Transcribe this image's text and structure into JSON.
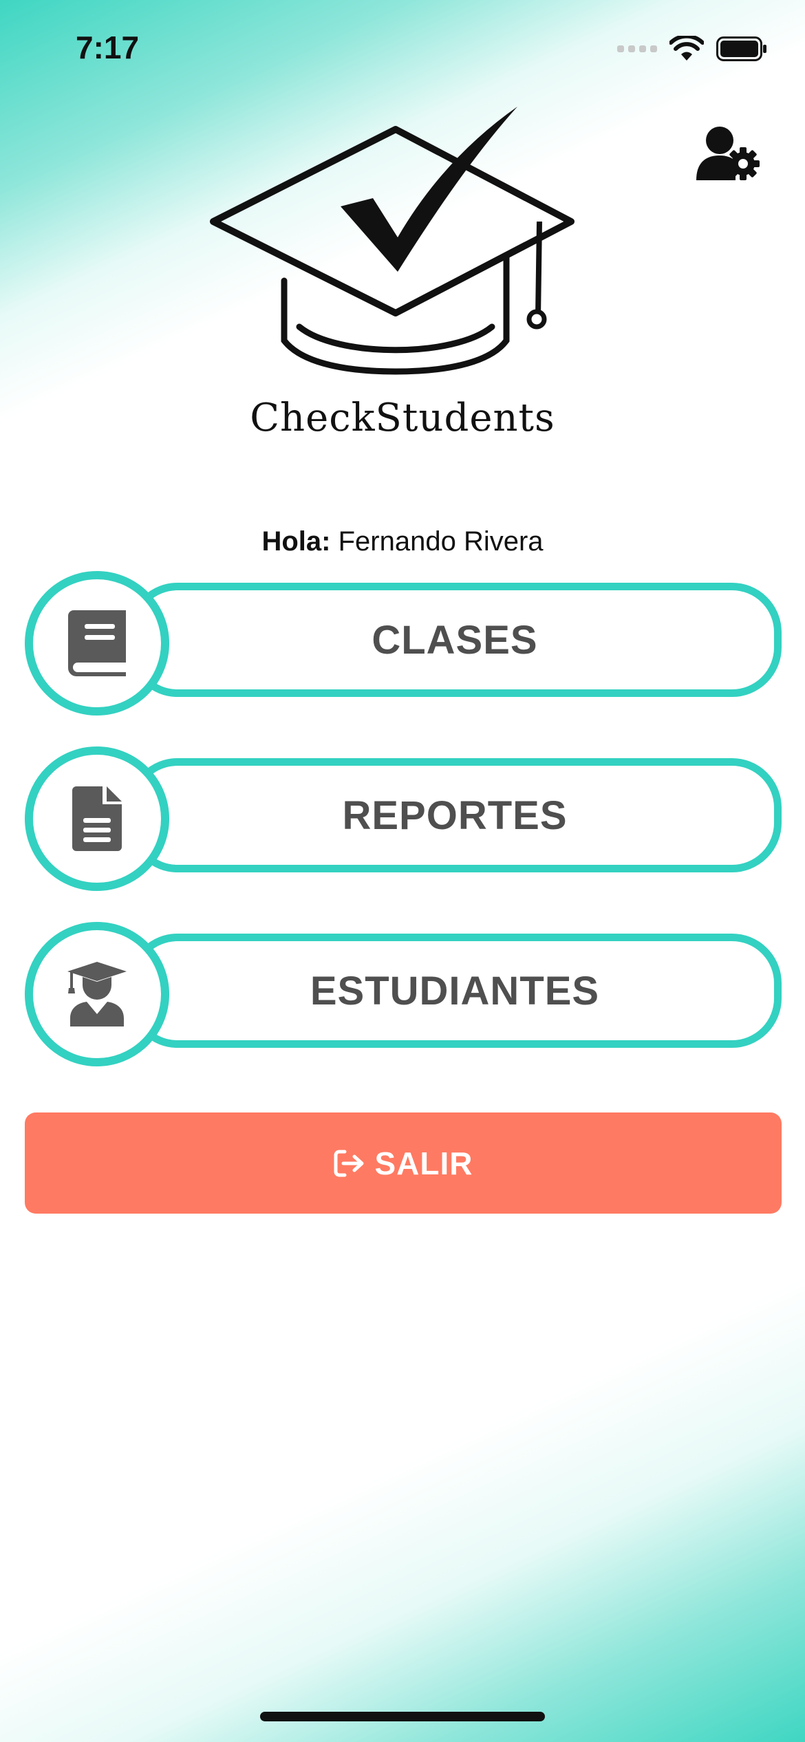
{
  "status_bar": {
    "time": "7:17"
  },
  "logo": {
    "app_name": "CheckStudents"
  },
  "greeting": {
    "prefix": "Hola:",
    "user_name": "Fernando Rivera"
  },
  "menu": {
    "items": [
      {
        "label": "CLASES",
        "icon": "book-icon"
      },
      {
        "label": "REPORTES",
        "icon": "document-icon"
      },
      {
        "label": "ESTUDIANTES",
        "icon": "graduate-icon"
      }
    ]
  },
  "logout": {
    "label": "SALIR",
    "icon": "sign-out-icon"
  },
  "colors": {
    "accent": "#33d1c1",
    "logout": "#ff7a62",
    "label": "#4f4f4f"
  }
}
